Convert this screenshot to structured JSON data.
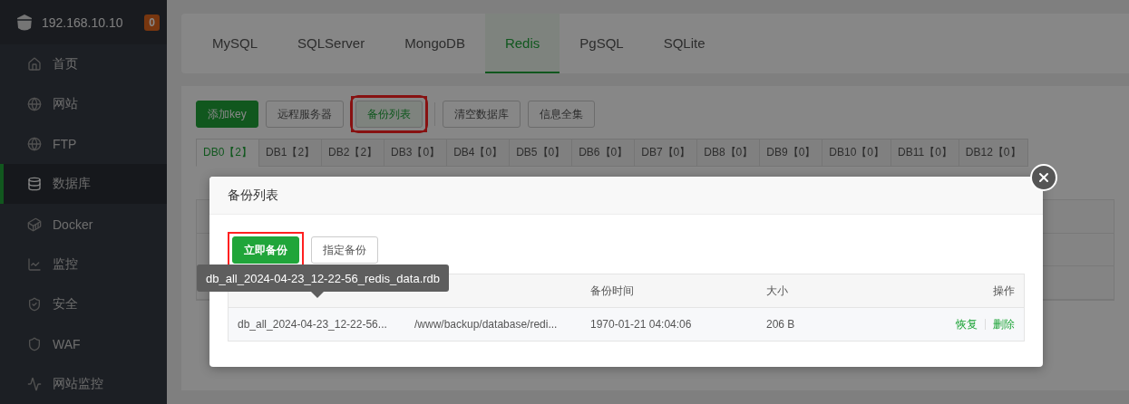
{
  "sidebar": {
    "host": "192.168.10.10",
    "badge": "0",
    "items": [
      {
        "label": "首页",
        "selected": false
      },
      {
        "label": "网站",
        "selected": false
      },
      {
        "label": "FTP",
        "selected": false
      },
      {
        "label": "数据库",
        "selected": true
      },
      {
        "label": "Docker",
        "selected": false
      },
      {
        "label": "监控",
        "selected": false
      },
      {
        "label": "安全",
        "selected": false
      },
      {
        "label": "WAF",
        "selected": false
      },
      {
        "label": "网站监控",
        "selected": false
      }
    ]
  },
  "db_types": [
    {
      "label": "MySQL",
      "selected": false
    },
    {
      "label": "SQLServer",
      "selected": false
    },
    {
      "label": "MongoDB",
      "selected": false
    },
    {
      "label": "Redis",
      "selected": true
    },
    {
      "label": "PgSQL",
      "selected": false
    },
    {
      "label": "SQLite",
      "selected": false
    }
  ],
  "toolbar": [
    {
      "label": "添加key",
      "kind": "primary",
      "highlighted": false
    },
    {
      "label": "远程服务器",
      "kind": "default",
      "highlighted": false
    },
    {
      "label": "备份列表",
      "kind": "default",
      "highlighted": true
    },
    {
      "label": "清空数据库",
      "kind": "default",
      "highlighted": false
    },
    {
      "label": "信息全集",
      "kind": "default",
      "highlighted": false
    }
  ],
  "db_tabs": [
    {
      "label": "DB0【2】",
      "selected": true
    },
    {
      "label": "DB1【2】",
      "selected": false
    },
    {
      "label": "DB2【2】",
      "selected": false
    },
    {
      "label": "DB3【0】",
      "selected": false
    },
    {
      "label": "DB4【0】",
      "selected": false
    },
    {
      "label": "DB5【0】",
      "selected": false
    },
    {
      "label": "DB6【0】",
      "selected": false
    },
    {
      "label": "DB7【0】",
      "selected": false
    },
    {
      "label": "DB8【0】",
      "selected": false
    },
    {
      "label": "DB9【0】",
      "selected": false
    },
    {
      "label": "DB10【0】",
      "selected": false
    },
    {
      "label": "DB11【0】",
      "selected": false
    },
    {
      "label": "DB12【0】",
      "selected": false
    }
  ],
  "dialog": {
    "title": "备份列表",
    "buttons": [
      {
        "label": "立即备份",
        "kind": "primary",
        "highlighted": true
      },
      {
        "label": "指定备份",
        "kind": "default",
        "highlighted": false
      }
    ],
    "tooltip": "db_all_2024-04-23_12-22-56_redis_data.rdb",
    "table": {
      "columns": [
        "",
        "",
        "备份时间",
        "大小",
        "操作"
      ],
      "rows": [
        {
          "cells": [
            "db_all_2024-04-23_12-22-56...",
            "/www/backup/database/redi...",
            "1970-01-21 04:04:06",
            "206 B"
          ],
          "actions": [
            "恢复",
            "删除"
          ]
        }
      ]
    }
  }
}
